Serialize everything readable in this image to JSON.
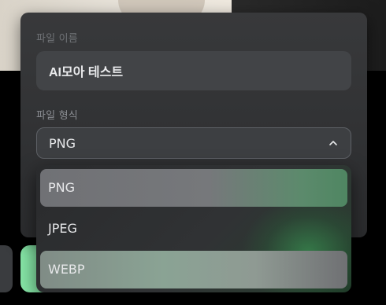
{
  "dialog": {
    "file_name_label": "파일 이름",
    "file_name_value": "AI모아 테스트",
    "file_format_label": "파일 형식",
    "selected_format": "PNG"
  },
  "format_options": [
    "PNG",
    "JPEG",
    "WEBP"
  ],
  "icons": {
    "select_chevron": "chevron-up-icon"
  },
  "colors": {
    "accent_green": "#86e6a7",
    "panel_bg": "#2f3032"
  }
}
